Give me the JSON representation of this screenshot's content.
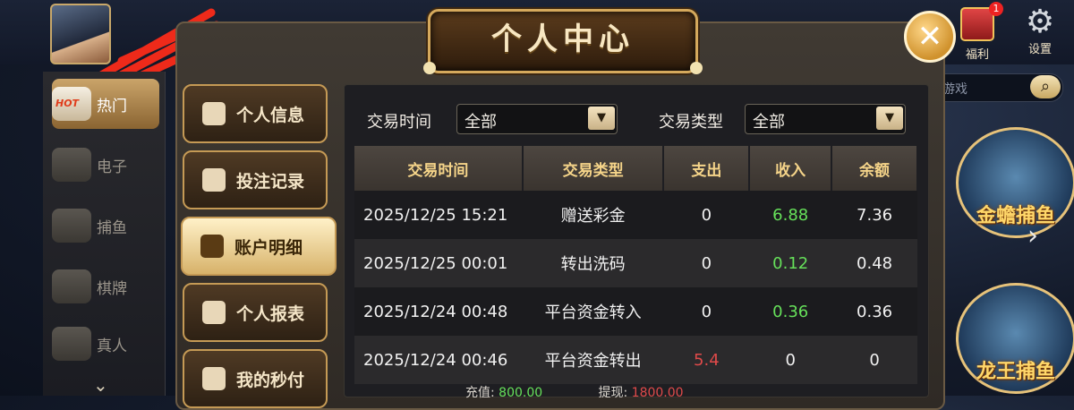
{
  "lobby": {
    "nav_items": [
      {
        "icon": "hot-icon",
        "label": "热门",
        "badge": "HOT"
      },
      {
        "icon": "slot-machine-icon",
        "label": "电子"
      },
      {
        "icon": "fish-icon",
        "label": "捕鱼"
      },
      {
        "icon": "cards-icon",
        "label": "棋牌"
      },
      {
        "icon": "dealer-icon",
        "label": "真人"
      }
    ],
    "gift_label": "福利",
    "gift_badge": "1",
    "settings_label": "设置",
    "search_placeholder": "游戏",
    "games": [
      {
        "label": "金蟾捕鱼"
      },
      {
        "label": "龙王捕鱼"
      }
    ]
  },
  "modal": {
    "title": "个人中心",
    "close_icon": "close-icon",
    "tabs": [
      {
        "label": "个人信息",
        "icon": "person-icon"
      },
      {
        "label": "投注记录",
        "icon": "ticket-icon"
      },
      {
        "label": "账户明细",
        "icon": "ledger-icon",
        "active": true
      },
      {
        "label": "个人报表",
        "icon": "pie-chart-icon"
      },
      {
        "label": "我的秒付",
        "icon": "m-logo-icon"
      }
    ],
    "filters": {
      "time_label": "交易时间",
      "time_value": "全部",
      "type_label": "交易类型",
      "type_value": "全部"
    },
    "table": {
      "headers": [
        "交易时间",
        "交易类型",
        "支出",
        "收入",
        "余额"
      ],
      "rows": [
        {
          "time": "2025/12/25 15:21",
          "type": "赠送彩金",
          "out": "0",
          "in": "6.88",
          "balance": "7.36"
        },
        {
          "time": "2025/12/25 00:01",
          "type": "转出洗码",
          "out": "0",
          "in": "0.12",
          "balance": "0.48"
        },
        {
          "time": "2025/12/24 00:48",
          "type": "平台资金转入",
          "out": "0",
          "in": "0.36",
          "balance": "0.36"
        },
        {
          "time": "2025/12/24 00:46",
          "type": "平台资金转出",
          "out": "5.4",
          "in": "0",
          "balance": "0"
        }
      ]
    },
    "summary": {
      "deposit_label": "充值",
      "deposit_value": "800.00",
      "withdraw_label": "提现",
      "withdraw_value": "1800.00"
    }
  },
  "colors": {
    "accent_gold": "#d5a95c",
    "income_green": "#66e05a",
    "expense_red": "#e04a4a",
    "header_text": "#f5d489"
  }
}
